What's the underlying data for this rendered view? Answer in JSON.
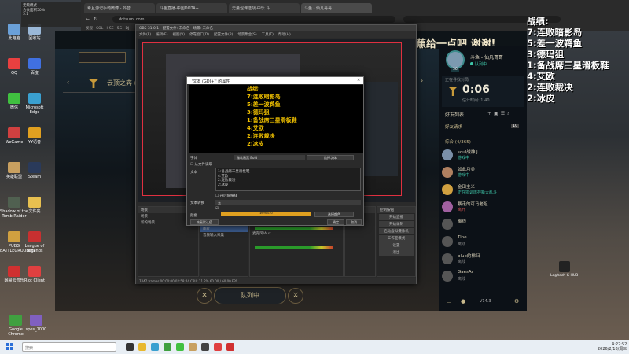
{
  "overlay": {
    "lines": [
      "战绩:",
      "7:连败暗影岛",
      "5:差一波鹈鱼",
      "3:德玛狙",
      "1:备战席三星滑板鞋",
      "4:艾欧",
      "2:连败裁决",
      "2:冰皮"
    ]
  },
  "stream_banner": "费的香蕉给一点吧 谢谢!",
  "browser": {
    "tabs": [
      "希互游记手动微博 - 抖音...",
      "斗鱼直播-中国DOTA+...",
      "无量涩课选战-中乐 斗...",
      "斗鱼 - 仙凡哥哥..."
    ],
    "address": "dotsumi.com",
    "bookmarks": [
      "发现",
      "SOL",
      "HSE",
      "5G",
      "DJ"
    ]
  },
  "float_window": {
    "title": "无敌模式",
    "line1": "合伙面积50%",
    "line2": "5.1"
  },
  "lol": {
    "mode_title": "云顶之弈 (排位)",
    "profile_name": "斗鱼 - 仙凡哥哥",
    "profile_status": "队列中",
    "level": "56",
    "in_queue_label": "正在寻找对局",
    "timer": "0:06",
    "estimated": "估计时间: 1:40",
    "friends_header": "好友列表",
    "friend_requests": "好友请求",
    "friend_requests_count": "10",
    "group_label": "综合 (4/365)",
    "friends": [
      {
        "name": "soul战神 J",
        "status": "游戏中",
        "status_color": "#3ec5a8",
        "avatar_color": "#7a8fa8"
      },
      {
        "name": "如此月美",
        "status": "游戏中",
        "status_color": "#3ec5a8",
        "avatar_color": "#b08060"
      },
      {
        "name": "金田主义",
        "status": "正在协调库存新大乱斗",
        "status_color": "#3ec5a8",
        "avatar_color": "#d0a040"
      },
      {
        "name": "暴走的可马老姐",
        "status": "离开",
        "status_color": "#c85050",
        "avatar_color": "#a060a0"
      },
      {
        "name": "离线",
        "status": "",
        "status_color": "#888",
        "avatar_color": "#555"
      },
      {
        "name": "Tine",
        "status": "离线",
        "status_color": "#888",
        "avatar_color": "#555"
      },
      {
        "name": "blue的梯归",
        "status": "离线",
        "status_color": "#888",
        "avatar_color": "#555"
      },
      {
        "name": "GaesAr",
        "status": "离线",
        "status_color": "#888",
        "avatar_color": "#555"
      }
    ],
    "queue_button": "队列中",
    "version": "V14.3"
  },
  "obs": {
    "title": "OBS 31.0.1 - 配置文件: 未命名 - 场景: 未命名",
    "menu": [
      "文件(F)",
      "编辑(E)",
      "视图(V)",
      "停靠窗口(D)",
      "配置文件(P)",
      "场景集合(S)",
      "工具(T)",
      "帮助(H)"
    ],
    "docks": {
      "scenes": "场景",
      "sources": "来源",
      "mixer": "混音器",
      "transitions": "转场特效",
      "controls": "控制按钮"
    },
    "scene_items": [
      "场景",
      "新的场景"
    ],
    "source_items": [
      "文本 (GDI+)",
      "显示器采集",
      "图片",
      "音频输入采集"
    ],
    "mixer_items": [
      "桌面音频",
      "麦克风/Aux"
    ],
    "controls": [
      "开始直播",
      "开始录制",
      "启动虚拟摄像机",
      "工作室模式",
      "设置",
      "退出"
    ],
    "status": "7447 frames  00:00:00  02:58:44  CPU: 11.2%  60.00 / 60.00 FPS"
  },
  "props": {
    "title": "'文本 (GDI+)' 的属性",
    "preview_text": [
      "战绩:",
      "7:连败暗影岛",
      "5:差一波鹈鱼",
      "3:德玛狙",
      "1:备战席三星滑板鞋",
      "4:艾欧",
      "2:连败裁决",
      "2:冰皮"
    ],
    "font_label": "字体",
    "font_value": "微软雅黑 Bold",
    "font_button": "选择字体",
    "from_file": "从文件读取",
    "text_label": "文本",
    "textarea": [
      "1:备战席三星滑板鞋",
      "4:艾欧",
      "2:连败裁决",
      "2:冰皮"
    ],
    "vertical": "开启纵横排",
    "transform_label": "文本转换",
    "transform_value": "无",
    "color_label": "颜色",
    "color_value": "#ffffa020",
    "color_button": "选择颜色",
    "bg_label": "背景不透明度",
    "defaults_button": "恢复默认值",
    "ok_button": "确定",
    "cancel_button": "取消"
  },
  "desktop_icons": [
    {
      "label": "此电脑",
      "color": "#6aa0d8"
    },
    {
      "label": "回收站",
      "color": "#9ab8d8"
    },
    {
      "label": "QQ",
      "color": "#e84040"
    },
    {
      "label": "百度",
      "color": "#4070e0"
    },
    {
      "label": "微信",
      "color": "#40c040"
    },
    {
      "label": "Microsoft Edge",
      "color": "#3aa0d0"
    },
    {
      "label": "WeGame",
      "color": "#d04040"
    },
    {
      "label": "YY语音",
      "color": "#e0a020"
    },
    {
      "label": "英雄联盟",
      "color": "#c8a060"
    },
    {
      "label": "Steam",
      "color": "#2a3a5a"
    },
    {
      "label": "Shadow of the Tomb Raider",
      "color": "#506050"
    },
    {
      "label": "文件夹",
      "color": "#e8c050"
    },
    {
      "label": "PUBG BATTLEGROUNDS",
      "color": "#d0a040"
    },
    {
      "label": "League of Legends",
      "color": "#c83030"
    },
    {
      "label": "网易云音乐",
      "color": "#d03030"
    },
    {
      "label": "Riot Client",
      "color": "#e04040"
    },
    {
      "label": "Google Chrome",
      "color": "#40a040"
    },
    {
      "label": "spes_1000",
      "color": "#8060c0"
    }
  ],
  "taskbar": {
    "search_placeholder": "搜索",
    "time": "4:22:52",
    "date": "2026/2/18/周三"
  },
  "logitech": "Logitech G HUB"
}
